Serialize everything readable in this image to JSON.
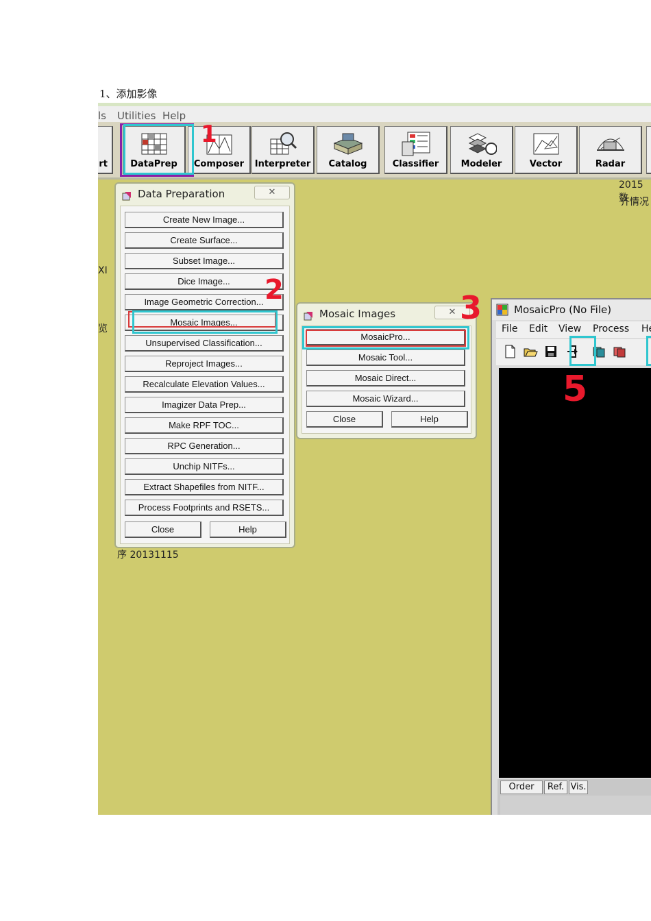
{
  "heading": "1、添加影像",
  "app_menu": [
    "ls",
    "Utilities",
    "Help"
  ],
  "toolbar": {
    "left_partial": "rt",
    "tools": [
      {
        "label": "DataPrep",
        "icon": "dataprep-icon"
      },
      {
        "label": "Composer",
        "icon": "composer-icon"
      },
      {
        "label": "Interpreter",
        "icon": "interpreter-icon"
      },
      {
        "label": "Catalog",
        "icon": "catalog-icon"
      },
      {
        "label": "Classifier",
        "icon": "classifier-icon"
      },
      {
        "label": "Modeler",
        "icon": "modeler-icon"
      },
      {
        "label": "Vector",
        "icon": "vector-icon"
      },
      {
        "label": "Radar",
        "icon": "radar-icon"
      }
    ]
  },
  "background_text": {
    "right_top1": "2015数",
    "right_top2": "齐情况",
    "left_xi": "XI",
    "left_lan": "浏览",
    "bottom": "序 20131115"
  },
  "data_prep": {
    "title": "Data Preparation",
    "close_x": "✕",
    "items": [
      "Create New Image...",
      "Create Surface...",
      "Subset Image...",
      "Dice Image...",
      "Image Geometric Correction...",
      "Mosaic Images...",
      "Unsupervised Classification...",
      "Reproject Images...",
      "Recalculate Elevation Values...",
      "Imagizer Data Prep...",
      "Make RPF TOC...",
      "RPC Generation...",
      "Unchip NITFs...",
      "Extract Shapefiles from NITF...",
      "Process Footprints and RSETS..."
    ],
    "close_label": "Close",
    "help_label": "Help"
  },
  "mosaic_images": {
    "title": "Mosaic Images",
    "close_x": "✕",
    "items": [
      "MosaicPro...",
      "Mosaic Tool...",
      "Mosaic Direct...",
      "Mosaic Wizard..."
    ],
    "close_label": "Close",
    "help_label": "Help"
  },
  "mosaicpro": {
    "title": "MosaicPro (No File)",
    "menu": [
      "File",
      "Edit",
      "View",
      "Process",
      "He"
    ],
    "tools": [
      "new-file-icon",
      "open-folder-icon",
      "save-icon",
      "add-images-icon",
      "color-balance-icon",
      "cutline-icon"
    ],
    "columns": [
      "Order",
      "Ref.",
      "Vis."
    ]
  },
  "annotations": {
    "step1": "1",
    "step2": "2",
    "step3": "3",
    "step5": "5"
  },
  "colors": {
    "workspace": "#cfcb6e",
    "highlight_cyan": "#2fc6cf",
    "highlight_red": "#d83b3b",
    "annotation_red": "#e8192c",
    "highlight_purple": "#8b1fa6"
  }
}
